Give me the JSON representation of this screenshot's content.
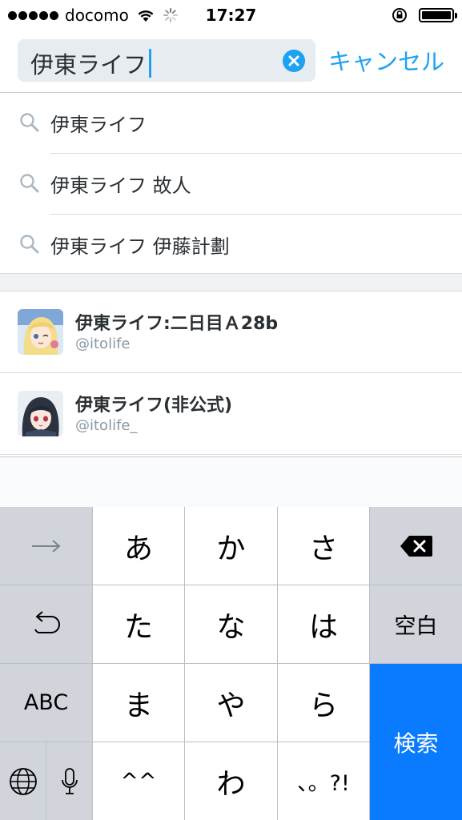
{
  "status_bar": {
    "carrier": "docomo",
    "time": "17:27"
  },
  "search": {
    "query": "伊東ライフ",
    "cancel_label": "キャンセル"
  },
  "suggestions": [
    {
      "label": "伊東ライフ"
    },
    {
      "label": "伊東ライフ 故人"
    },
    {
      "label": "伊東ライフ 伊藤計劃"
    }
  ],
  "users": [
    {
      "name": "伊東ライフ:二日目Ａ28b",
      "handle": "@itolife"
    },
    {
      "name": "伊東ライフ(非公式)",
      "handle": "@itolife_"
    }
  ],
  "keyboard": {
    "rows": [
      [
        "→",
        "あ",
        "か",
        "さ",
        "⌫"
      ],
      [
        "↺",
        "た",
        "な",
        "は",
        "空白"
      ],
      [
        "ABC",
        "ま",
        "や",
        "ら",
        "検索"
      ],
      [
        "🌐",
        "🎤",
        "^^",
        "わ",
        "、。?!"
      ]
    ],
    "keys": {
      "next": "→",
      "a": "あ",
      "ka": "か",
      "sa": "さ",
      "ta": "た",
      "na": "な",
      "ha": "は",
      "space": "空白",
      "abc": "ABC",
      "ma": "ま",
      "ya": "や",
      "ra": "ら",
      "search": "検索",
      "emoticon": "^^",
      "wa": "わ",
      "punct": "、。?!"
    }
  },
  "colors": {
    "accent": "#1da1f2",
    "search_key": "#0a7aff"
  }
}
